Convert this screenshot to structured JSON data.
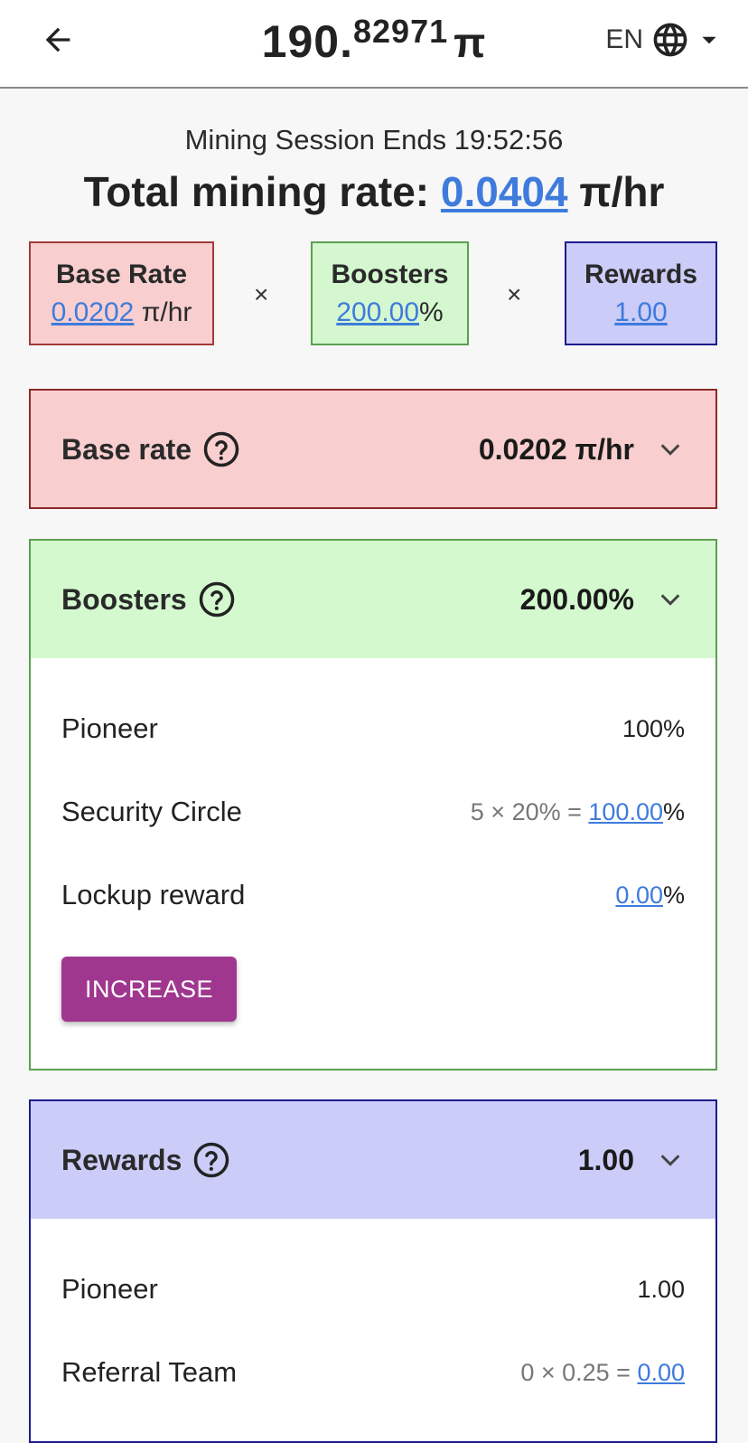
{
  "header": {
    "balance_int": "190.",
    "balance_frac": "82971",
    "balance_unit": "π",
    "language": "EN"
  },
  "session": {
    "label": "Mining Session Ends 19:52:56"
  },
  "total_rate": {
    "label": "Total mining rate:",
    "value": "0.0404",
    "unit": "π/hr"
  },
  "summary": {
    "base": {
      "title": "Base Rate",
      "value": "0.0202",
      "unit": "π/hr"
    },
    "boosters": {
      "title": "Boosters",
      "value": "200.00",
      "unit": "%"
    },
    "rewards": {
      "title": "Rewards",
      "value": "1.00"
    },
    "times_symbol": "×"
  },
  "base_panel": {
    "title": "Base rate",
    "value": "0.0202 π/hr"
  },
  "boosters_panel": {
    "title": "Boosters",
    "value": "200.00%",
    "rows": [
      {
        "label": "Pioneer",
        "value": "100%"
      },
      {
        "label": "Security Circle",
        "formula": "5 × 20% = ",
        "link": "100.00",
        "suffix": "%"
      },
      {
        "label": "Lockup reward",
        "link": "0.00",
        "suffix": "%"
      }
    ],
    "button_label": "INCREASE"
  },
  "rewards_panel": {
    "title": "Rewards",
    "value": "1.00",
    "rows": [
      {
        "label": "Pioneer",
        "value": "1.00"
      },
      {
        "label": "Referral Team",
        "formula": "0 × 0.25 = ",
        "link": "0.00"
      }
    ]
  },
  "colors": {
    "accent_link": "#3e7bdc",
    "base_bg": "#f8cece",
    "boost_bg": "#d4f7cf",
    "rewards_bg": "#cbccf8",
    "increase_button": "#a0378f"
  },
  "icons": [
    "arrow-left-icon",
    "globe-icon",
    "caret-down-icon",
    "help-circle-icon",
    "chevron-down-icon"
  ]
}
